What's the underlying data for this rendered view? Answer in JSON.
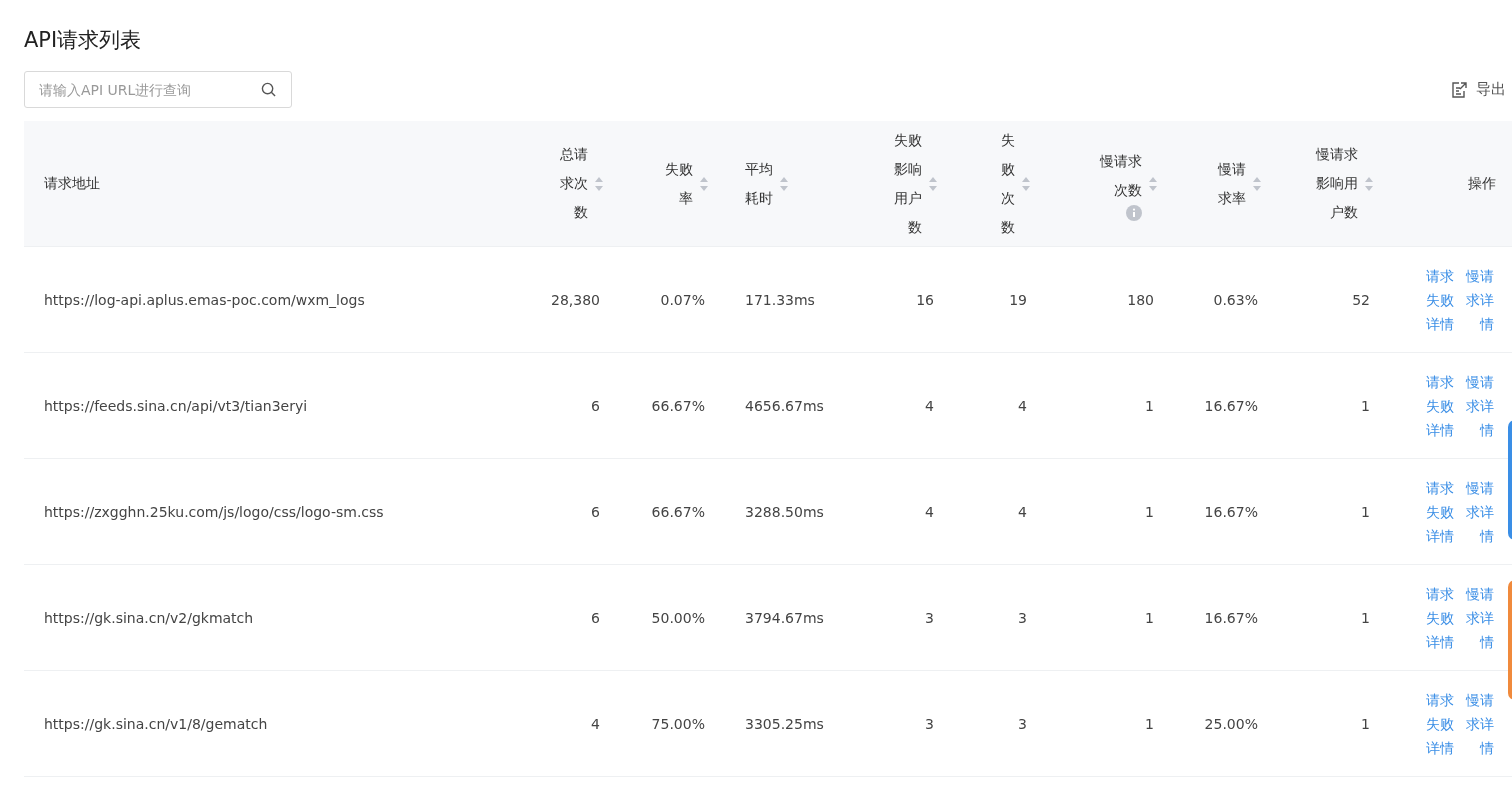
{
  "title": "API请求列表",
  "search": {
    "placeholder": "请输入API URL进行查询"
  },
  "export_button": "导出",
  "table": {
    "columns": [
      {
        "label": "请求地址",
        "sortable": false,
        "info": false
      },
      {
        "label": "总请求次数",
        "sortable": true,
        "info": false
      },
      {
        "label": "失败率",
        "sortable": true,
        "info": false
      },
      {
        "label": "平均耗时",
        "sortable": true,
        "info": false
      },
      {
        "label": "失败影响用户数",
        "sortable": true,
        "info": false
      },
      {
        "label": "失败次数",
        "sortable": true,
        "info": false
      },
      {
        "label": "慢请求次数",
        "sortable": true,
        "info": true
      },
      {
        "label": "慢请求率",
        "sortable": true,
        "info": false
      },
      {
        "label": "慢请求影响用户数",
        "sortable": true,
        "info": false
      },
      {
        "label": "操作",
        "sortable": false,
        "info": false
      }
    ],
    "rows": [
      {
        "url": "https://log-api.aplus.emas-poc.com/wxm_logs",
        "values": [
          "28,380",
          "0.07%",
          "171.33ms",
          "16",
          "19",
          "180",
          "0.63%",
          "52"
        ],
        "actions": [
          "请求失败详情",
          "慢请求详情"
        ]
      },
      {
        "url": "https://feeds.sina.cn/api/vt3/tian3eryi",
        "values": [
          "6",
          "66.67%",
          "4656.67ms",
          "4",
          "4",
          "1",
          "16.67%",
          "1"
        ],
        "actions": [
          "请求失败详情",
          "慢请求详情"
        ]
      },
      {
        "url": "https://zxgghn.25ku.com/js/logo/css/logo-sm.css",
        "values": [
          "6",
          "66.67%",
          "3288.50ms",
          "4",
          "4",
          "1",
          "16.67%",
          "1"
        ],
        "actions": [
          "请求失败详情",
          "慢请求详情"
        ]
      },
      {
        "url": "https://gk.sina.cn/v2/gkmatch",
        "values": [
          "6",
          "50.00%",
          "3794.67ms",
          "3",
          "3",
          "1",
          "16.67%",
          "1"
        ],
        "actions": [
          "请求失败详情",
          "慢请求详情"
        ]
      },
      {
        "url": "https://gk.sina.cn/v1/8/gematch",
        "values": [
          "4",
          "75.00%",
          "3305.25ms",
          "3",
          "3",
          "1",
          "25.00%",
          "1"
        ],
        "actions": [
          "请求失败详情",
          "慢请求详情"
        ]
      }
    ]
  }
}
